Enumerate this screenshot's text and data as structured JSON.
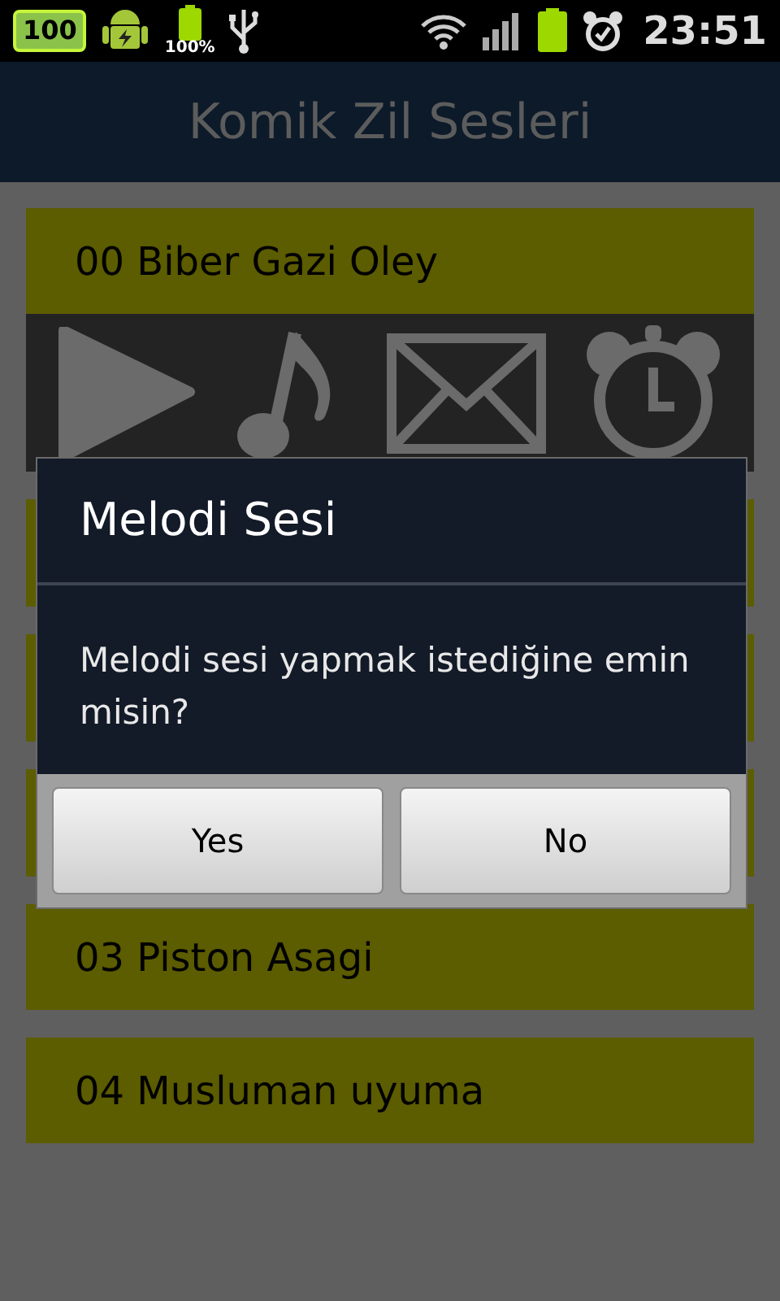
{
  "status_bar": {
    "battery_badge": "100",
    "battery_percent": "100%",
    "time": "23:51"
  },
  "title": "Komik Zil Sesleri",
  "items": [
    {
      "kind": "item",
      "title": "00 Biber Gazi Oley",
      "expanded": true
    },
    {
      "kind": "covered"
    },
    {
      "kind": "covered"
    },
    {
      "kind": "covered"
    },
    {
      "kind": "item",
      "title": "03 Piston Asagi",
      "expanded": false
    },
    {
      "kind": "item",
      "title": "04 Musluman uyuma",
      "expanded": false
    }
  ],
  "dialog": {
    "title": "Melodi Sesi",
    "message": "Melodi sesi yapmak istediğine emin misin?",
    "buttons": [
      "Yes",
      "No"
    ]
  }
}
